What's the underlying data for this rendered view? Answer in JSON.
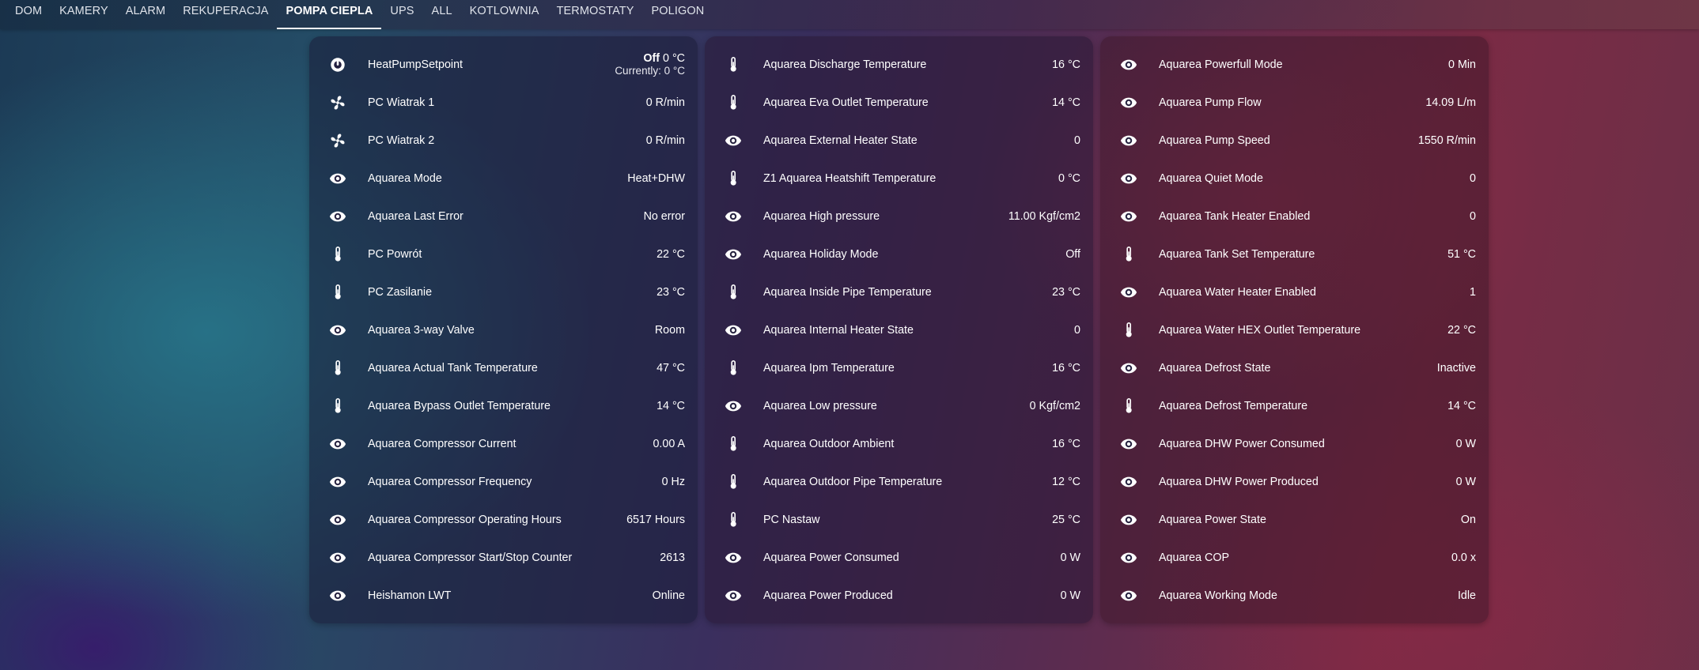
{
  "tabs": [
    "DOM",
    "KAMERY",
    "ALARM",
    "REKUPERACJA",
    "POMPA CIEPLA",
    "UPS",
    "ALL",
    "KOTLOWNIA",
    "TERMOSTATY",
    "POLIGON"
  ],
  "active_tab": "POMPA CIEPLA",
  "thermostat": {
    "name": "HeatPumpSetpoint",
    "state": "Off",
    "target": "0 °C",
    "current": "Currently: 0 °C"
  },
  "card1": [
    {
      "icon": "fan-icon",
      "name": "PC Wiatrak 1",
      "value": "0 R/min"
    },
    {
      "icon": "fan-icon",
      "name": "PC Wiatrak 2",
      "value": "0 R/min"
    },
    {
      "icon": "eye-icon",
      "name": "Aquarea Mode",
      "value": "Heat+DHW"
    },
    {
      "icon": "eye-icon",
      "name": "Aquarea Last Error",
      "value": "No error"
    },
    {
      "icon": "thermometer-icon",
      "name": "PC Powrót",
      "value": "22 °C"
    },
    {
      "icon": "thermometer-icon",
      "name": "PC Zasilanie",
      "value": "23 °C"
    },
    {
      "icon": "eye-icon",
      "name": "Aquarea 3-way Valve",
      "value": "Room"
    },
    {
      "icon": "thermometer-icon",
      "name": "Aquarea Actual Tank Temperature",
      "value": "47 °C"
    },
    {
      "icon": "thermometer-icon",
      "name": "Aquarea Bypass Outlet Temperature",
      "value": "14 °C"
    },
    {
      "icon": "eye-icon",
      "name": "Aquarea Compressor Current",
      "value": "0.00 A"
    },
    {
      "icon": "eye-icon",
      "name": "Aquarea Compressor Frequency",
      "value": "0 Hz"
    },
    {
      "icon": "eye-icon",
      "name": "Aquarea Compressor Operating Hours",
      "value": "6517 Hours"
    },
    {
      "icon": "eye-icon",
      "name": "Aquarea Compressor Start/Stop Counter",
      "value": "2613"
    },
    {
      "icon": "eye-icon",
      "name": "Heishamon LWT",
      "value": "Online"
    }
  ],
  "card2": [
    {
      "icon": "thermometer-icon",
      "name": "Aquarea Discharge Temperature",
      "value": "16 °C"
    },
    {
      "icon": "thermometer-icon",
      "name": "Aquarea Eva Outlet Temperature",
      "value": "14 °C"
    },
    {
      "icon": "eye-icon",
      "name": "Aquarea External Heater State",
      "value": "0"
    },
    {
      "icon": "thermometer-icon",
      "name": "Z1 Aquarea Heatshift Temperature",
      "value": "0 °C"
    },
    {
      "icon": "eye-icon",
      "name": "Aquarea High pressure",
      "value": "11.00 Kgf/cm2"
    },
    {
      "icon": "eye-icon",
      "name": "Aquarea Holiday Mode",
      "value": "Off"
    },
    {
      "icon": "thermometer-icon",
      "name": "Aquarea Inside Pipe Temperature",
      "value": "23 °C"
    },
    {
      "icon": "eye-icon",
      "name": "Aquarea Internal Heater State",
      "value": "0"
    },
    {
      "icon": "thermometer-icon",
      "name": "Aquarea Ipm Temperature",
      "value": "16 °C"
    },
    {
      "icon": "eye-icon",
      "name": "Aquarea Low pressure",
      "value": "0 Kgf/cm2"
    },
    {
      "icon": "thermometer-icon",
      "name": "Aquarea Outdoor Ambient",
      "value": "16 °C"
    },
    {
      "icon": "thermometer-icon",
      "name": "Aquarea Outdoor Pipe Temperature",
      "value": "12 °C"
    },
    {
      "icon": "thermometer-icon",
      "name": "PC Nastaw",
      "value": "25 °C"
    },
    {
      "icon": "eye-icon",
      "name": "Aquarea Power Consumed",
      "value": "0 W"
    },
    {
      "icon": "eye-icon",
      "name": "Aquarea Power Produced",
      "value": "0 W"
    }
  ],
  "card3": [
    {
      "icon": "eye-icon",
      "name": "Aquarea Powerfull Mode",
      "value": "0 Min"
    },
    {
      "icon": "eye-icon",
      "name": "Aquarea Pump Flow",
      "value": "14.09 L/m"
    },
    {
      "icon": "eye-icon",
      "name": "Aquarea Pump Speed",
      "value": "1550 R/min"
    },
    {
      "icon": "eye-icon",
      "name": "Aquarea Quiet Mode",
      "value": "0"
    },
    {
      "icon": "eye-icon",
      "name": "Aquarea Tank Heater Enabled",
      "value": "0"
    },
    {
      "icon": "thermometer-icon",
      "name": "Aquarea Tank Set Temperature",
      "value": "51 °C"
    },
    {
      "icon": "eye-icon",
      "name": "Aquarea Water Heater Enabled",
      "value": "1"
    },
    {
      "icon": "thermometer-icon",
      "name": "Aquarea Water HEX Outlet Temperature",
      "value": "22 °C"
    },
    {
      "icon": "eye-icon",
      "name": "Aquarea Defrost State",
      "value": "Inactive"
    },
    {
      "icon": "thermometer-icon",
      "name": "Aquarea Defrost Temperature",
      "value": "14 °C"
    },
    {
      "icon": "eye-icon",
      "name": "Aquarea DHW Power Consumed",
      "value": "0 W"
    },
    {
      "icon": "eye-icon",
      "name": "Aquarea DHW Power Produced",
      "value": "0 W"
    },
    {
      "icon": "eye-icon",
      "name": "Aquarea Power State",
      "value": "On"
    },
    {
      "icon": "eye-icon",
      "name": "Aquarea COP",
      "value": "0.0 x"
    },
    {
      "icon": "eye-icon",
      "name": "Aquarea Working Mode",
      "value": "Idle"
    }
  ]
}
